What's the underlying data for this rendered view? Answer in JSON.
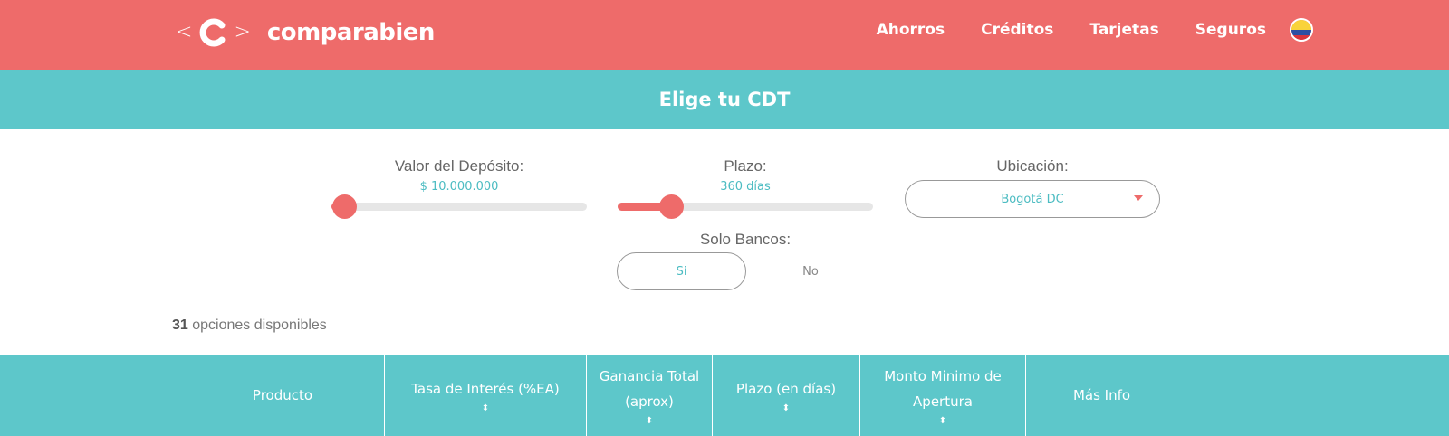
{
  "header": {
    "logo": {
      "left_chevron": "<",
      "right_chevron": ">",
      "brand": "comparabien"
    },
    "nav": [
      "Ahorros",
      "Créditos",
      "Tarjetas",
      "Seguros"
    ],
    "flag_icon": "colombia-flag-icon"
  },
  "page": {
    "title": "Elige tu CDT"
  },
  "filters": {
    "deposit": {
      "label": "Valor del Depósito:",
      "value": "$ 10.000.000",
      "level": 0.05
    },
    "term": {
      "label": "Plazo:",
      "value": "360 días",
      "level": 0.21
    },
    "location": {
      "label": "Ubicación:",
      "value": "Bogotá DC"
    },
    "banks_only": {
      "label": "Solo Bancos:",
      "yes": "Si",
      "no": "No",
      "selected": "Si"
    }
  },
  "results": {
    "count": "31",
    "count_text": "opciones disponibles"
  },
  "table": {
    "columns": [
      {
        "label": "Producto",
        "sortable": false
      },
      {
        "label": "Tasa de Interés (%EA)",
        "sortable": true
      },
      {
        "label": "Ganancia Total (aprox)",
        "sortable": true
      },
      {
        "label": "Plazo (en días)",
        "sortable": true
      },
      {
        "label": "Monto Minimo de Apertura",
        "sortable": true
      },
      {
        "label": "Más Info",
        "sortable": false
      }
    ],
    "sort_icon": "⬍"
  },
  "colors": {
    "coral": "#ee6b6a",
    "teal": "#5dc7ca",
    "teal_text": "#4cbcc2"
  }
}
